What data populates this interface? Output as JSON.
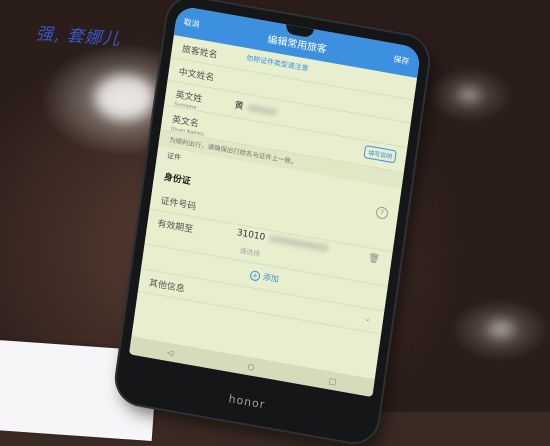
{
  "scene": {
    "description_colors": {
      "table": "#4a332b",
      "screen": "#e7efcf",
      "accent": "#3d8fe0"
    }
  },
  "handwriting": "强, 套娜儿",
  "phone": {
    "brand": "honor",
    "appbar": {
      "back": "取消",
      "title": "编辑常用旅客",
      "save": "保存"
    },
    "rows": {
      "type_label": "旅客姓名",
      "type_link": "勿称证件类型请注意",
      "cn_name_label": "中文姓名",
      "en_surname_label": "英文姓",
      "en_surname_sub": "Surname",
      "en_surname_value": "黄",
      "en_given_label": "英文名",
      "en_given_sub": "Given Names",
      "en_given_btn": "填写说明"
    },
    "notice": "为顺利出行，请确保出行姓名与证件上一致。",
    "id_label": "证件",
    "id_type": "身份证",
    "id_number_label": "证件号码",
    "validity_label": "有效期至",
    "id_number_value": "31010",
    "validity_placeholder": "请选择",
    "add_label": "添加",
    "other_label": "其他信息",
    "icons": [
      "back",
      "help-circle",
      "trash",
      "plus-circle",
      "chevron-down",
      "nav-back",
      "nav-home",
      "nav-recent"
    ]
  }
}
